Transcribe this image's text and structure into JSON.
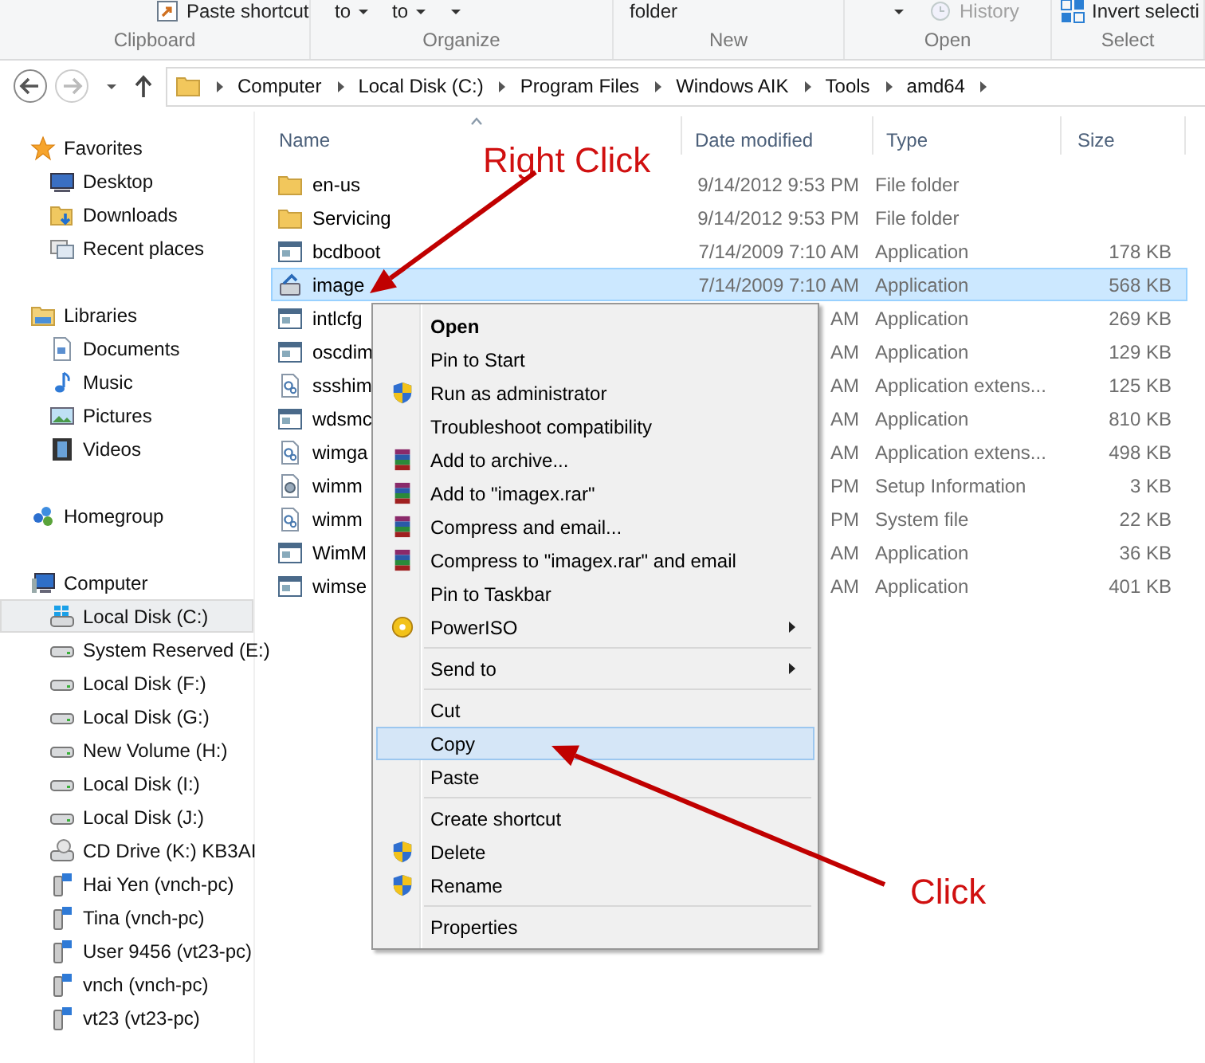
{
  "ribbon": [
    {
      "label": "Clipboard",
      "items": [
        {
          "label": "Paste shortcut",
          "kind": "shortcut",
          "caret": false,
          "disabled": false
        }
      ]
    },
    {
      "label": "Organize",
      "items": [
        {
          "label": "to",
          "kind": "plain",
          "caret": true,
          "disabled": false
        },
        {
          "label": "to",
          "kind": "plain",
          "caret": true,
          "disabled": false
        },
        {
          "kind": "plain",
          "caret": true,
          "disabled": false
        }
      ]
    },
    {
      "label": "New",
      "items": [
        {
          "label": "folder",
          "kind": "plain",
          "caret": false,
          "disabled": false
        }
      ]
    },
    {
      "label": "Open",
      "items": [
        {
          "kind": "plain",
          "caret": true,
          "disabled": false
        },
        {
          "label": "History",
          "kind": "history",
          "caret": false,
          "disabled": true
        }
      ]
    },
    {
      "label": "Select",
      "items": [
        {
          "label": "Invert selecti",
          "kind": "select",
          "caret": false,
          "disabled": false
        }
      ]
    }
  ],
  "address": {
    "crumbs": [
      "Computer",
      "Local Disk (C:)",
      "Program Files",
      "Windows AIK",
      "Tools",
      "amd64"
    ]
  },
  "nav": [
    {
      "label": "Favorites",
      "kind": "star",
      "selected": false,
      "children": [
        {
          "label": "Desktop",
          "kind": "desktop",
          "selected": false
        },
        {
          "label": "Downloads",
          "kind": "downloads",
          "selected": false
        },
        {
          "label": "Recent places",
          "kind": "recent",
          "selected": false
        }
      ]
    },
    {
      "label": "Libraries",
      "kind": "library",
      "selected": false,
      "children": [
        {
          "label": "Documents",
          "kind": "documents",
          "selected": false
        },
        {
          "label": "Music",
          "kind": "music",
          "selected": false
        },
        {
          "label": "Pictures",
          "kind": "pictures",
          "selected": false
        },
        {
          "label": "Videos",
          "kind": "videos",
          "selected": false
        }
      ]
    },
    {
      "label": "Homegroup",
      "kind": "homegroup",
      "selected": false
    },
    {
      "label": "Computer",
      "kind": "computer",
      "selected": false,
      "children": [
        {
          "label": "Local Disk (C:)",
          "kind": "windrive",
          "selected": true
        },
        {
          "label": "System Reserved (E:)",
          "kind": "drive",
          "selected": false
        },
        {
          "label": "Local Disk (F:)",
          "kind": "drive",
          "selected": false
        },
        {
          "label": "Local Disk (G:)",
          "kind": "drive",
          "selected": false
        },
        {
          "label": "New Volume (H:)",
          "kind": "drive",
          "selected": false
        },
        {
          "label": "Local Disk (I:)",
          "kind": "drive",
          "selected": false
        },
        {
          "label": "Local Disk (J:)",
          "kind": "drive",
          "selected": false
        },
        {
          "label": "CD Drive (K:) KB3AI",
          "kind": "cd",
          "selected": false
        },
        {
          "label": "Hai Yen (vnch-pc)",
          "kind": "netdrive",
          "selected": false
        },
        {
          "label": "Tina (vnch-pc)",
          "kind": "netdrive",
          "selected": false
        },
        {
          "label": "User 9456 (vt23-pc)",
          "kind": "netdrive",
          "selected": false
        },
        {
          "label": "vnch (vnch-pc)",
          "kind": "netdrive",
          "selected": false
        },
        {
          "label": "vt23 (vt23-pc)",
          "kind": "netdrive",
          "selected": false
        }
      ]
    }
  ],
  "files": {
    "columns": [
      {
        "label": "Name",
        "sorted": true
      },
      {
        "label": "Date modified",
        "sorted": false
      },
      {
        "label": "Type",
        "sorted": false
      },
      {
        "label": "Size",
        "sorted": false
      }
    ],
    "rows": [
      {
        "name": "en-us",
        "date": "9/14/2012 9:53 PM",
        "type": "File folder",
        "kind": "folder",
        "selected": false
      },
      {
        "name": "Servicing",
        "date": "9/14/2012 9:53 PM",
        "type": "File folder",
        "kind": "folder",
        "selected": false
      },
      {
        "name": "bcdboot",
        "date": "7/14/2009 7:10 AM",
        "type": "Application",
        "size": "178 KB",
        "kind": "app",
        "selected": false
      },
      {
        "name": "image",
        "date": "7/14/2009 7:10 AM",
        "type": "Application",
        "size": "568 KB",
        "kind": "imagex",
        "selected": true
      },
      {
        "name": "intlcfg",
        "date": "AM",
        "type": "Application",
        "size": "269 KB",
        "kind": "app",
        "selected": false
      },
      {
        "name": "oscdim",
        "date": "AM",
        "type": "Application",
        "size": "129 KB",
        "kind": "app",
        "selected": false
      },
      {
        "name": "ssshim",
        "date": "AM",
        "type": "Application extens...",
        "size": "125 KB",
        "kind": "dll",
        "selected": false
      },
      {
        "name": "wdsmc",
        "date": "AM",
        "type": "Application",
        "size": "810 KB",
        "kind": "app",
        "selected": false
      },
      {
        "name": "wimga",
        "date": "AM",
        "type": "Application extens...",
        "size": "498 KB",
        "kind": "dll",
        "selected": false
      },
      {
        "name": "wimm",
        "date": "PM",
        "type": "Setup Information",
        "size": "3 KB",
        "kind": "setup",
        "selected": false
      },
      {
        "name": "wimm",
        "date": "PM",
        "type": "System file",
        "size": "22 KB",
        "kind": "dll",
        "selected": false
      },
      {
        "name": "WimM",
        "date": "AM",
        "type": "Application",
        "size": "36 KB",
        "kind": "app",
        "selected": false
      },
      {
        "name": "wimse",
        "date": "AM",
        "type": "Application",
        "size": "401 KB",
        "kind": "app",
        "selected": false
      }
    ]
  },
  "context_menu": [
    {
      "kind": "plain",
      "label": "Open",
      "default": true,
      "selected": false,
      "submenu": false
    },
    {
      "kind": "plain",
      "label": "Pin to Start",
      "default": false,
      "selected": false,
      "submenu": false
    },
    {
      "kind": "shield",
      "label": "Run as administrator",
      "default": false,
      "selected": false,
      "submenu": false
    },
    {
      "kind": "plain",
      "label": "Troubleshoot compatibility",
      "default": false,
      "selected": false,
      "submenu": false
    },
    {
      "kind": "archive",
      "label": "Add to archive...",
      "default": false,
      "selected": false,
      "submenu": false
    },
    {
      "kind": "archive",
      "label": "Add to \"imagex.rar\"",
      "default": false,
      "selected": false,
      "submenu": false
    },
    {
      "kind": "archive",
      "label": "Compress and email...",
      "default": false,
      "selected": false,
      "submenu": false
    },
    {
      "kind": "archive",
      "label": "Compress to \"imagex.rar\" and email",
      "default": false,
      "selected": false,
      "submenu": false
    },
    {
      "kind": "plain",
      "label": "Pin to Taskbar",
      "default": false,
      "selected": false,
      "submenu": false
    },
    {
      "kind": "disc",
      "label": "PowerISO",
      "default": false,
      "selected": false,
      "submenu": true
    },
    {
      "kind": "separator"
    },
    {
      "kind": "plain",
      "label": "Send to",
      "default": false,
      "selected": false,
      "submenu": true
    },
    {
      "kind": "separator"
    },
    {
      "kind": "plain",
      "label": "Cut",
      "default": false,
      "selected": false,
      "submenu": false
    },
    {
      "kind": "plain",
      "label": "Copy",
      "default": false,
      "selected": true,
      "submenu": false
    },
    {
      "kind": "plain",
      "label": "Paste",
      "default": false,
      "selected": false,
      "submenu": false
    },
    {
      "kind": "separator"
    },
    {
      "kind": "plain",
      "label": "Create shortcut",
      "default": false,
      "selected": false,
      "submenu": false
    },
    {
      "kind": "shield",
      "label": "Delete",
      "default": false,
      "selected": false,
      "submenu": false
    },
    {
      "kind": "shield",
      "label": "Rename",
      "default": false,
      "selected": false,
      "submenu": false
    },
    {
      "kind": "separator"
    },
    {
      "kind": "plain",
      "label": "Properties",
      "default": false,
      "selected": false,
      "submenu": false
    }
  ],
  "annotations": [
    {
      "text": "Right Click"
    },
    {
      "text": "Click"
    }
  ]
}
